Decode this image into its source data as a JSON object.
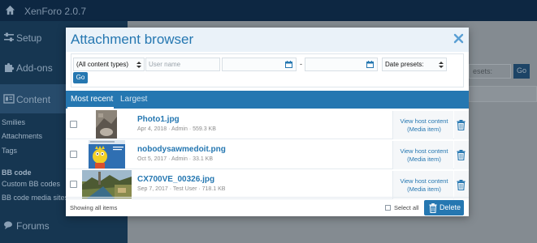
{
  "app": {
    "title": "XenForo 2.0.7"
  },
  "sidebar": {
    "sections": [
      {
        "label": "Setup",
        "icon": "sliders-icon"
      },
      {
        "label": "Add-ons",
        "icon": "puzzle-icon"
      },
      {
        "label": "Content",
        "icon": "content-icon"
      },
      {
        "label": "Forums",
        "icon": "comments-icon"
      }
    ],
    "content_items": [
      "Smilies",
      "Attachments",
      "Tags"
    ],
    "bb_heading": "BB code",
    "bb_items": [
      "Custom BB codes",
      "BB code media sites"
    ]
  },
  "background": {
    "presets_text": "esets:",
    "go_label": "Go"
  },
  "modal": {
    "title": "Attachment browser",
    "close_icon": "close-icon"
  },
  "filters": {
    "content_type": "(All content types)",
    "user_placeholder": "User name",
    "date_separator": "-",
    "date_presets": "Date presets:",
    "go_label": "Go"
  },
  "tabs": [
    {
      "label": "Most recent",
      "active": true
    },
    {
      "label": "Largest",
      "active": false
    }
  ],
  "attachments": [
    {
      "name": "Photo1.jpg",
      "meta": "Apr 4, 2018 · Admin · 559.3 KB",
      "host_link": "View host content",
      "host_type": "(Media item)"
    },
    {
      "name": "nobodysawmedoit.png",
      "meta": "Oct 5, 2017 · Admin · 33.1 KB",
      "host_link": "View host content",
      "host_type": "(Media item)"
    },
    {
      "name": "CX700VE_00326.jpg",
      "meta": "Sep 7, 2017 · Test User · 718.1 KB",
      "host_link": "View host content",
      "host_type": "(Media item)"
    }
  ],
  "footer": {
    "showing": "Showing all items",
    "select_all": "Select all",
    "delete_label": "Delete"
  },
  "colors": {
    "accent": "#2577b1",
    "nav_dark": "#0d2742",
    "sidebar": "#163651"
  }
}
